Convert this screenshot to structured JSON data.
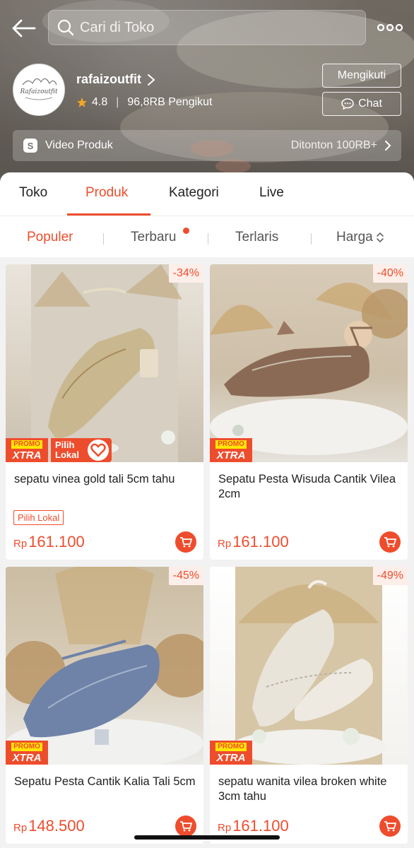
{
  "header": {
    "search_placeholder": "Cari di Toko",
    "shop_name": "rafaizoutfit",
    "rating": "4.8",
    "followers": "96,8RB Pengikut",
    "follow_label": "Mengikuti",
    "chat_label": "Chat",
    "video_label": "Video Produk",
    "video_views": "Ditonton 100RB+",
    "avatar_logo_text": "Rafaizoutfit"
  },
  "tabs": [
    {
      "label": "Toko"
    },
    {
      "label": "Produk"
    },
    {
      "label": "Kategori"
    },
    {
      "label": "Live"
    }
  ],
  "active_tab": "Produk",
  "sort": [
    {
      "label": "Populer"
    },
    {
      "label": "Terbaru"
    },
    {
      "label": "Terlaris"
    },
    {
      "label": "Harga"
    }
  ],
  "active_sort": "Populer",
  "products": [
    {
      "title": "sepatu vinea gold tali 5cm tahu",
      "discount": "-34%",
      "currency": "Rp",
      "price": "161.100",
      "promo_top": "PROMO",
      "promo_bottom": "XTRA",
      "lokal_banner": "Pilih Lokal",
      "lokal_tag": "Pilih Lokal",
      "color": "#c9b88f"
    },
    {
      "title": "Sepatu Pesta Wisuda Cantik Vilea 2cm",
      "discount": "-40%",
      "currency": "Rp",
      "price": "161.100",
      "promo_top": "PROMO",
      "promo_bottom": "XTRA",
      "color": "#8b6a55"
    },
    {
      "title": "Sepatu Pesta Cantik Kalia Tali 5cm",
      "discount": "-45%",
      "currency": "Rp",
      "price": "148.500",
      "promo_top": "PROMO",
      "promo_bottom": "XTRA",
      "color": "#6f83a8"
    },
    {
      "title": "sepatu wanita vilea broken white 3cm tahu",
      "discount": "-49%",
      "currency": "Rp",
      "price": "161.100",
      "promo_top": "PROMO",
      "promo_bottom": "XTRA",
      "color": "#e8e4da"
    }
  ],
  "colors": {
    "accent": "#ee4d2d",
    "promo_yellow": "#ffe600",
    "star": "#f5a623"
  }
}
